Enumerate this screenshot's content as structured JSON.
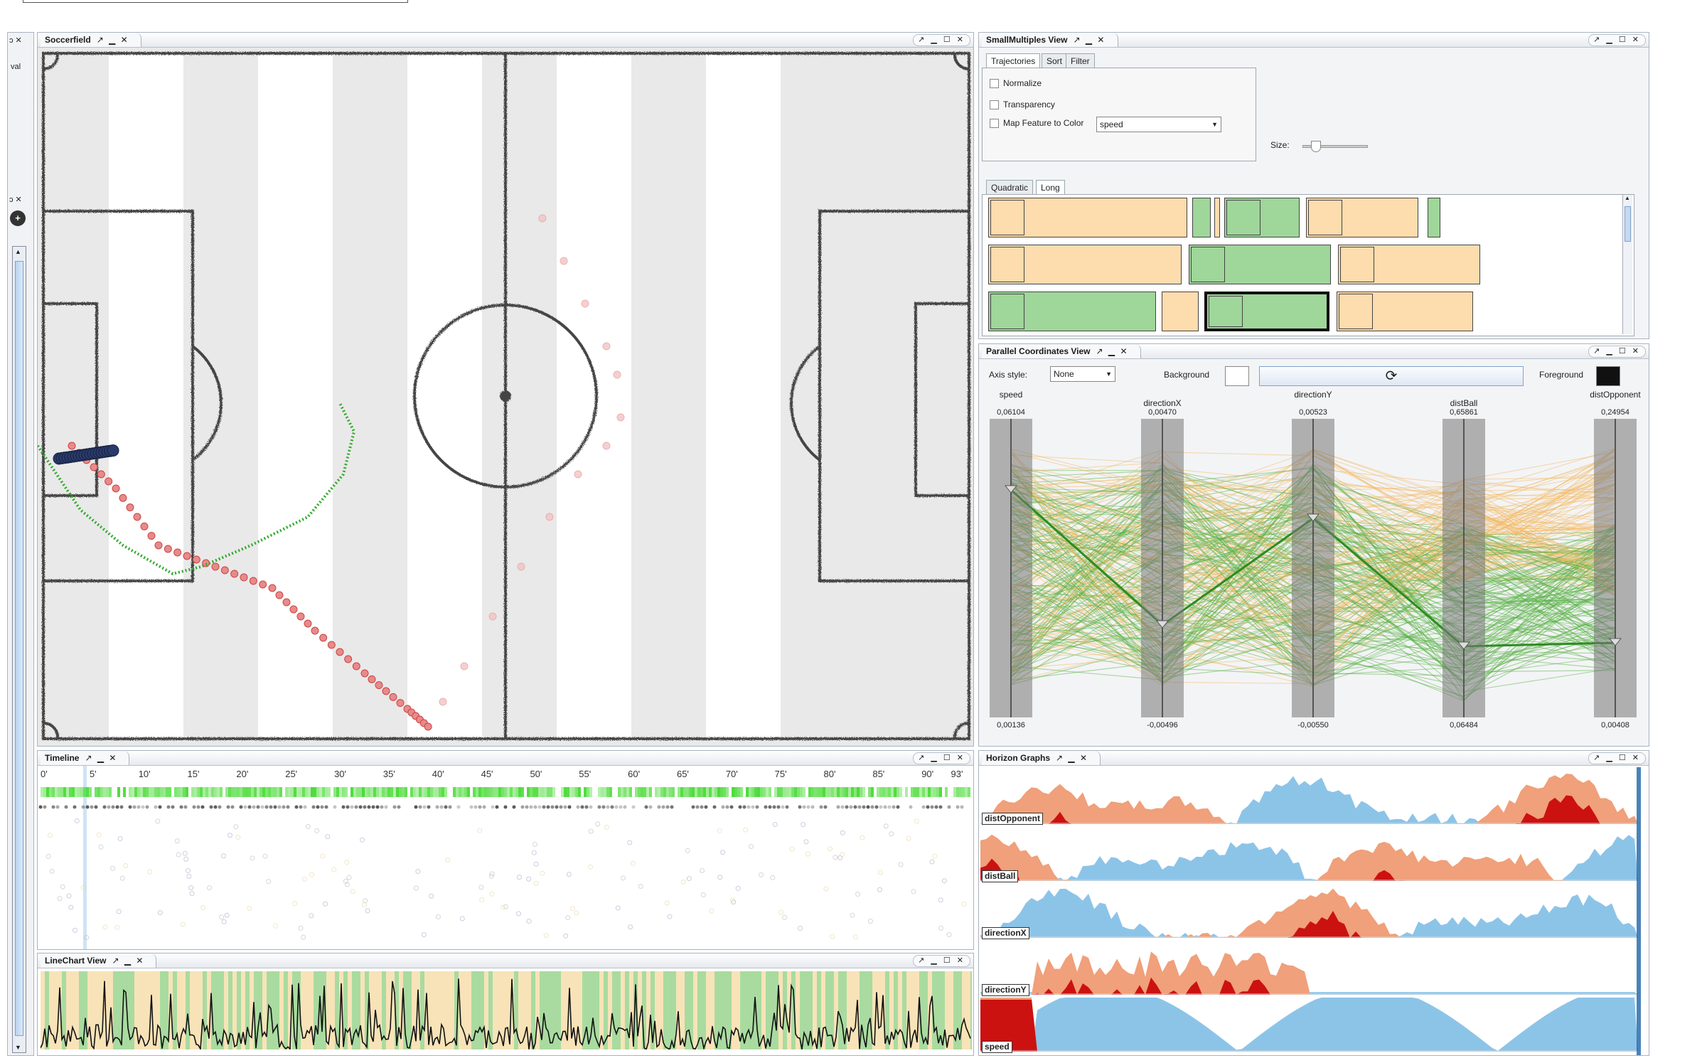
{
  "left_strip": {
    "text": "val",
    "close_top": "ɔ ✕",
    "close_mid": "ɔ ✕",
    "add_icon": "plus-icon"
  },
  "window_buttons": "↗ ▁ ☐ ✕",
  "soccerfield": {
    "title": "Soccerfield",
    "tab_icons": "↗ ▁ ✕"
  },
  "smallmultiples": {
    "title": "SmallMultiples View",
    "tab_icons": "↗ ▁ ✕",
    "tabs": [
      "Trajectories",
      "Sort",
      "Filter"
    ],
    "options": {
      "normalize": "Normalize",
      "transparency": "Transparency",
      "map_feature": "Map Feature to Color",
      "feature_value": "speed"
    },
    "size_label": "Size:",
    "size_value": 0.2,
    "view_tabs": [
      "Quadratic",
      "Long"
    ]
  },
  "parallel": {
    "title": "Parallel Coordinates View",
    "tab_icons": "↗ ▁ ✕",
    "axis_style_label": "Axis style:",
    "axis_style_value": "None",
    "background_label": "Background",
    "foreground_label": "Foreground",
    "axes": [
      {
        "name": "speed",
        "max": "0,06104",
        "min": "0,00136"
      },
      {
        "name": "directionX",
        "max": "0,00470",
        "min": "-0,00496"
      },
      {
        "name": "directionY",
        "max": "0,00523",
        "min": "-0,00550"
      },
      {
        "name": "distBall",
        "max": "0,65861",
        "min": "0,06484"
      },
      {
        "name": "distOpponent",
        "max": "0,24954",
        "min": "0,00408"
      }
    ],
    "colors": {
      "selected": "#2e8b22",
      "normal": "#55b040",
      "context": "#f5b860"
    }
  },
  "timeline": {
    "title": "Timeline",
    "tab_icons": "↗ ▁ ✕",
    "ticks": [
      "0'",
      "5'",
      "10'",
      "15'",
      "20'",
      "25'",
      "30'",
      "35'",
      "40'",
      "45'",
      "50'",
      "55'",
      "60'",
      "65'",
      "70'",
      "75'",
      "80'",
      "85'",
      "90'",
      "93'"
    ]
  },
  "linechart": {
    "title": "LineChart View",
    "tab_icons": "↗ ▁ ✕"
  },
  "horizon": {
    "title": "Horizon Graphs",
    "tab_icons": "↗ ▁ ✕",
    "rows": [
      "distOpponent",
      "distBall",
      "directionX",
      "directionY",
      "speed"
    ],
    "colors": {
      "pos1": "#f0a07a",
      "pos2": "#cc1111",
      "neg1": "#8cc4e8",
      "neg2": "#1b64a8"
    }
  }
}
